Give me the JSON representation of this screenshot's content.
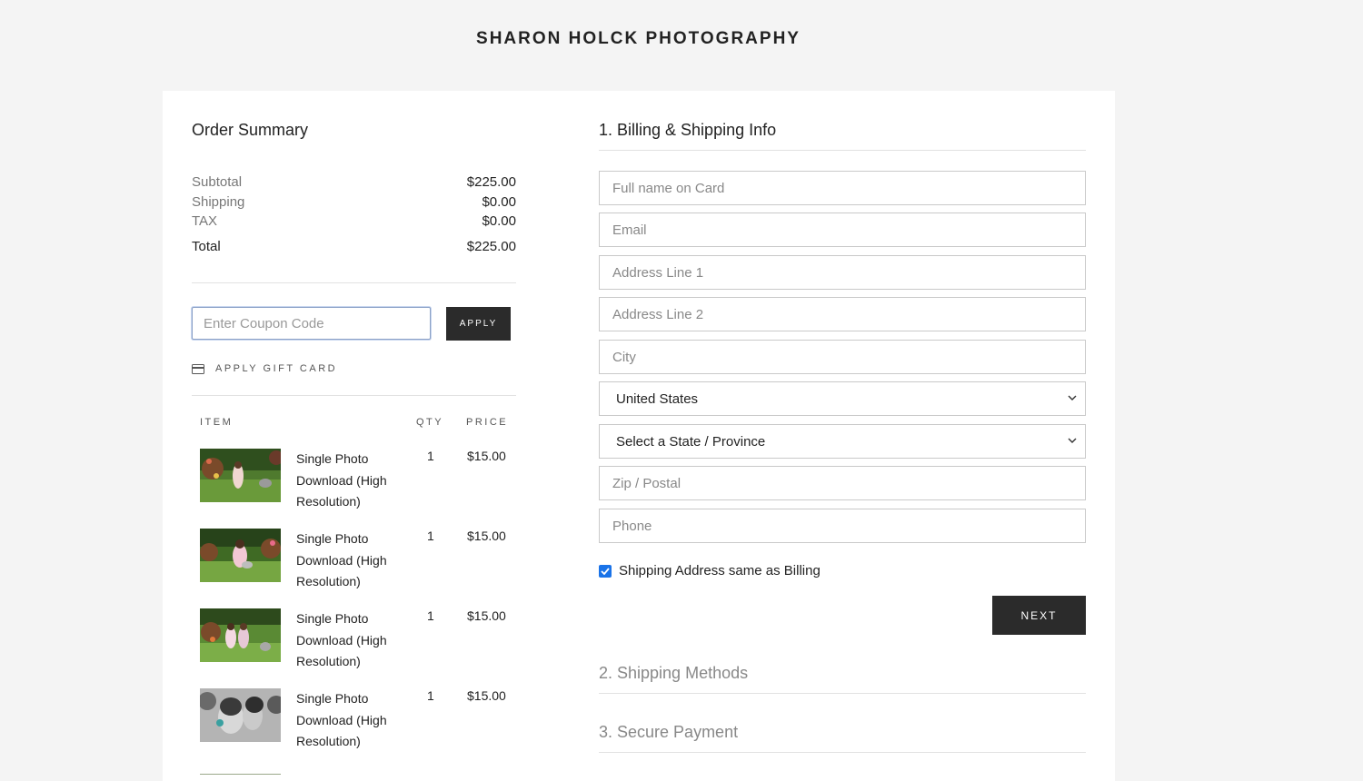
{
  "site": {
    "title": "SHARON HOLCK PHOTOGRAPHY"
  },
  "order": {
    "title": "Order Summary",
    "rows": [
      {
        "label": "Subtotal",
        "value": "$225.00"
      },
      {
        "label": "Shipping",
        "value": "$0.00"
      },
      {
        "label": "TAX",
        "value": "$0.00"
      }
    ],
    "total": {
      "label": "Total",
      "value": "$225.00"
    },
    "coupon_placeholder": "Enter Coupon Code",
    "apply_label": "APPLY",
    "gift_card_label": "APPLY GIFT CARD",
    "icons": {
      "gift_card": "credit-card-icon"
    },
    "table_headers": {
      "item": "ITEM",
      "qty": "QTY",
      "price": "PRICE"
    },
    "items": [
      {
        "name": "Single Photo Download (High Resolution)",
        "qty": "1",
        "price": "$15.00"
      },
      {
        "name": "Single Photo Download (High Resolution)",
        "qty": "1",
        "price": "$15.00"
      },
      {
        "name": "Single Photo Download (High Resolution)",
        "qty": "1",
        "price": "$15.00"
      },
      {
        "name": "Single Photo Download (High Resolution)",
        "qty": "1",
        "price": "$15.00"
      }
    ]
  },
  "billing": {
    "title": "1. Billing & Shipping Info",
    "placeholders": {
      "full_name": "Full name on Card",
      "email": "Email",
      "address1": "Address Line 1",
      "address2": "Address Line 2",
      "city": "City",
      "zip": "Zip / Postal",
      "phone": "Phone"
    },
    "country": "United States",
    "state": "Select a State / Province",
    "same_as_billing": "Shipping Address same as Billing",
    "next_label": "NEXT"
  },
  "sections": {
    "shipping_methods": "2. Shipping Methods",
    "secure_payment": "3. Secure Payment"
  },
  "colors": {
    "button": "#2b2b2b",
    "checkbox": "#1a73e8",
    "background": "#f4f4f4"
  }
}
